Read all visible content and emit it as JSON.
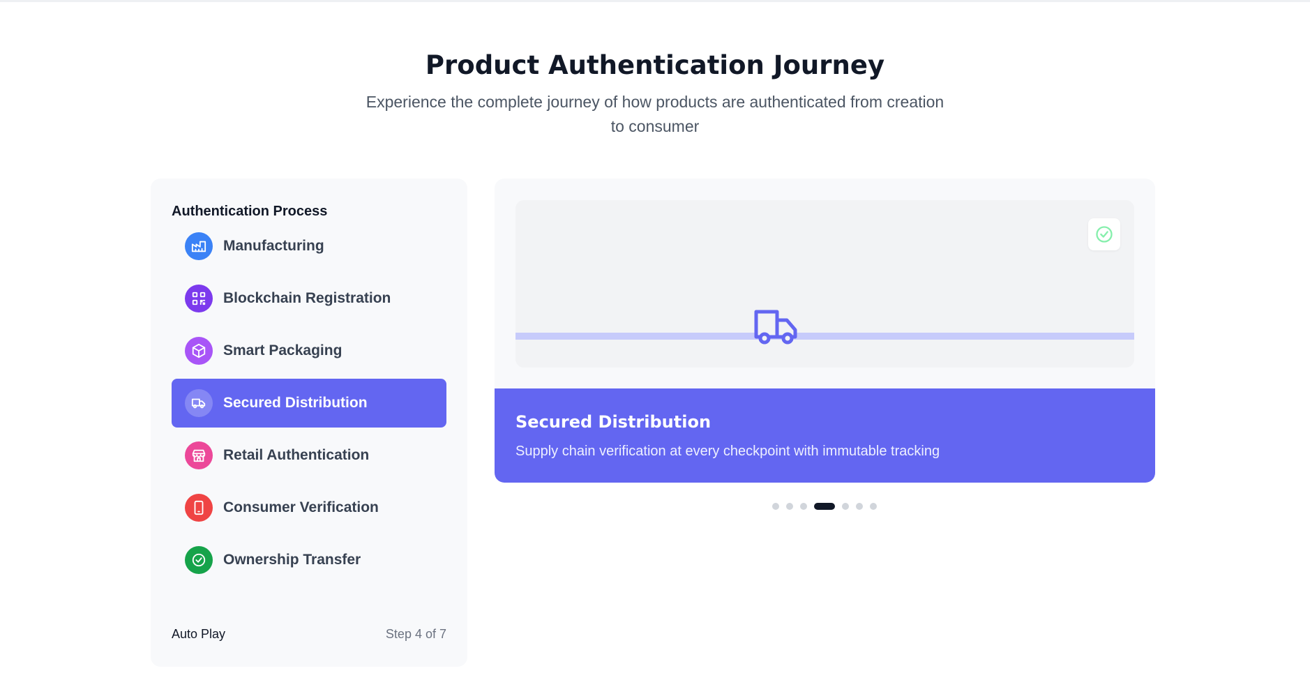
{
  "header": {
    "title": "Product Authentication Journey",
    "subtitle": "Experience the complete journey of how products are authenticated from creation to consumer"
  },
  "sidebar": {
    "title": "Authentication Process",
    "steps": [
      {
        "label": "Manufacturing",
        "icon": "factory-icon",
        "color": "#3b82f6"
      },
      {
        "label": "Blockchain Registration",
        "icon": "qr-code-icon",
        "color": "#7c3aed"
      },
      {
        "label": "Smart Packaging",
        "icon": "package-icon",
        "color": "#a855f7"
      },
      {
        "label": "Secured Distribution",
        "icon": "truck-icon",
        "color": "#6366f1",
        "active": true
      },
      {
        "label": "Retail Authentication",
        "icon": "store-icon",
        "color": "#ec4899"
      },
      {
        "label": "Consumer Verification",
        "icon": "smartphone-icon",
        "color": "#ef4444"
      },
      {
        "label": "Ownership Transfer",
        "icon": "check-circle-icon",
        "color": "#16a34a"
      }
    ],
    "footer": {
      "autoplay_label": "Auto Play",
      "step_counter": "Step 4 of 7"
    }
  },
  "panel": {
    "title": "Secured Distribution",
    "description": "Supply chain verification at every checkpoint with immutable tracking",
    "visual_icon": "truck-icon",
    "badge_icon": "check-circle-icon"
  },
  "pagination": {
    "total": 7,
    "current": 4
  },
  "colors": {
    "accent": "#6366f1",
    "track": "#c7cbfb",
    "badge_check": "#86efac"
  }
}
